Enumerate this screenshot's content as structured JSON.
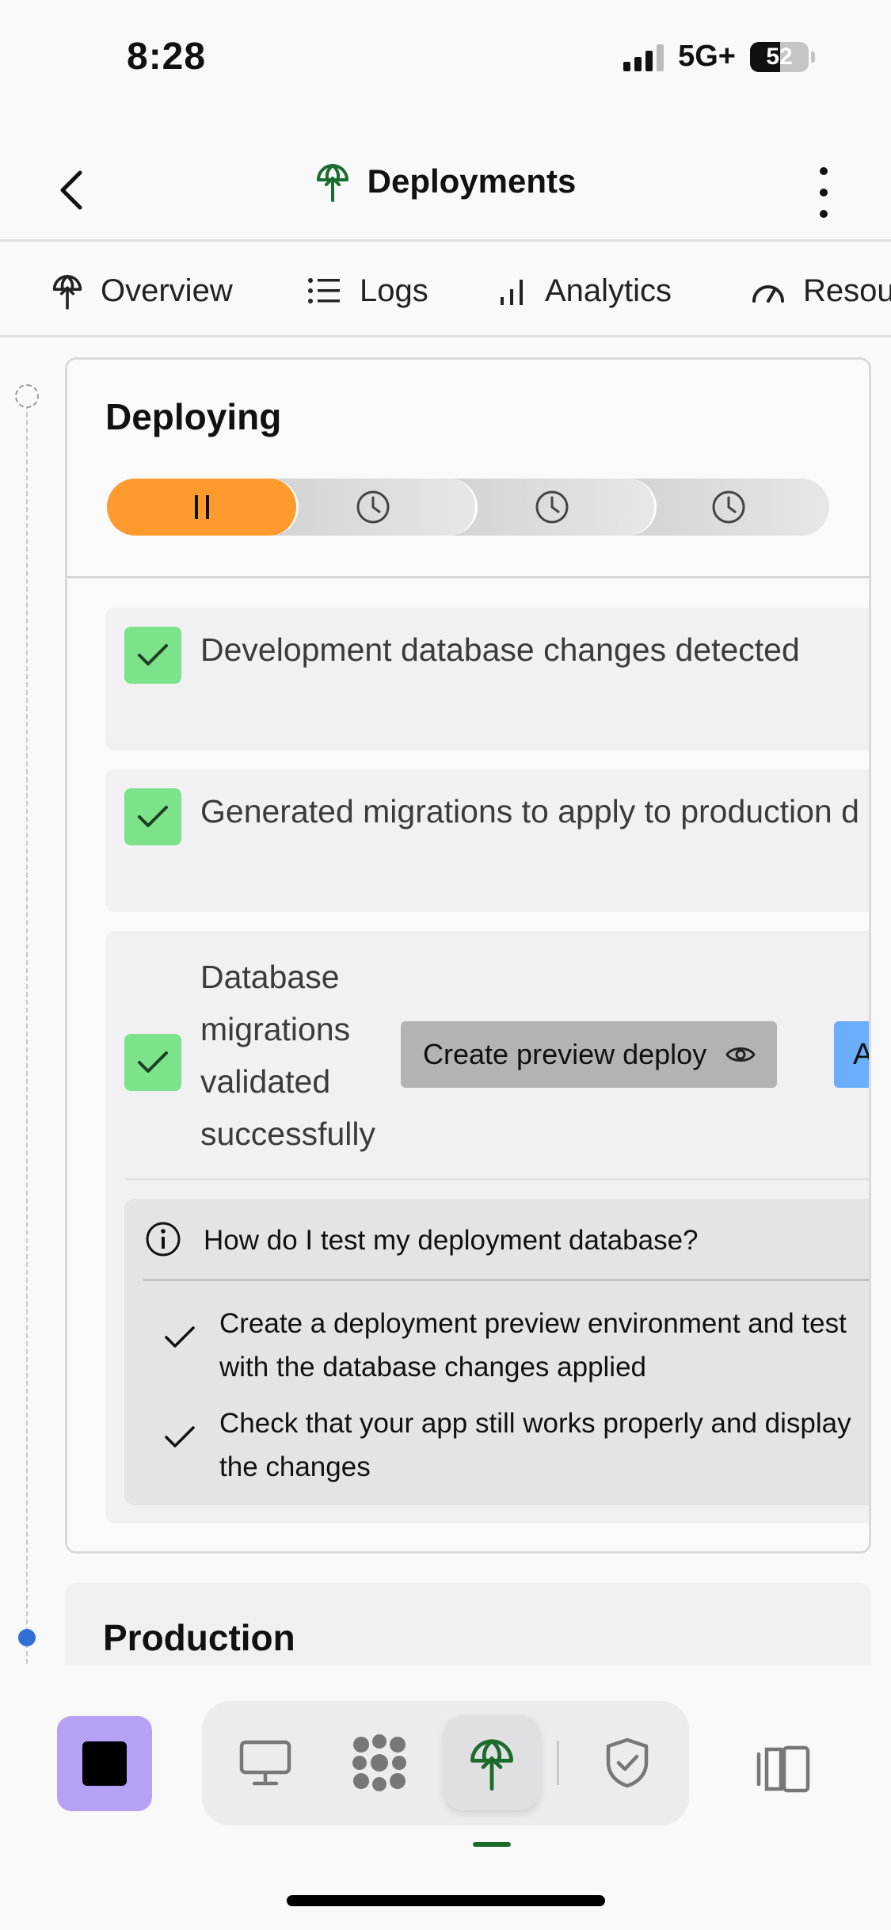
{
  "status_bar": {
    "time": "8:28",
    "network": "5G+",
    "battery": "52"
  },
  "header": {
    "title": "Deployments",
    "back_icon": "chevron-left-icon",
    "title_icon": "deploy-icon",
    "more_icon": "vertical-ellipsis-icon"
  },
  "tabs": [
    {
      "label": "Overview",
      "icon": "deploy-icon",
      "active": true
    },
    {
      "label": "Logs",
      "icon": "list-icon"
    },
    {
      "label": "Analytics",
      "icon": "bar-chart-icon"
    },
    {
      "label": "Resou",
      "icon": "gauge-icon"
    }
  ],
  "deploy_card": {
    "heading": "Deploying",
    "progress_steps": [
      {
        "state": "active",
        "icon": "pause-icon"
      },
      {
        "state": "pending",
        "icon": "clock-icon"
      },
      {
        "state": "pending",
        "icon": "clock-icon"
      },
      {
        "state": "pending",
        "icon": "clock-icon"
      }
    ],
    "steps": [
      {
        "label": "Development database changes detected",
        "done": true
      },
      {
        "label": "Generated migrations to apply to production d",
        "done": true
      },
      {
        "label": "Database migrations validated successfully",
        "lines": [
          "Database",
          "migrations",
          "validated",
          "successfully"
        ],
        "done": true
      }
    ],
    "preview_button": "Create preview deploy",
    "apply_button": "App",
    "info": {
      "question": "How do I test my deployment database?",
      "tips": [
        {
          "lines": [
            "Create a deployment preview environment and test",
            "with the database changes applied"
          ]
        },
        {
          "lines": [
            "Check that your app still works properly and display",
            "the changes"
          ]
        }
      ]
    }
  },
  "production_card": {
    "heading": "Production"
  },
  "colors": {
    "accent_orange": "#ff9a2e",
    "check_green": "#7ce38a",
    "apply_blue": "#6aaefc",
    "stop_purple": "#b5a2f7",
    "deploy_green": "#1a6b2c",
    "timeline_blue": "#2f6fd6"
  }
}
